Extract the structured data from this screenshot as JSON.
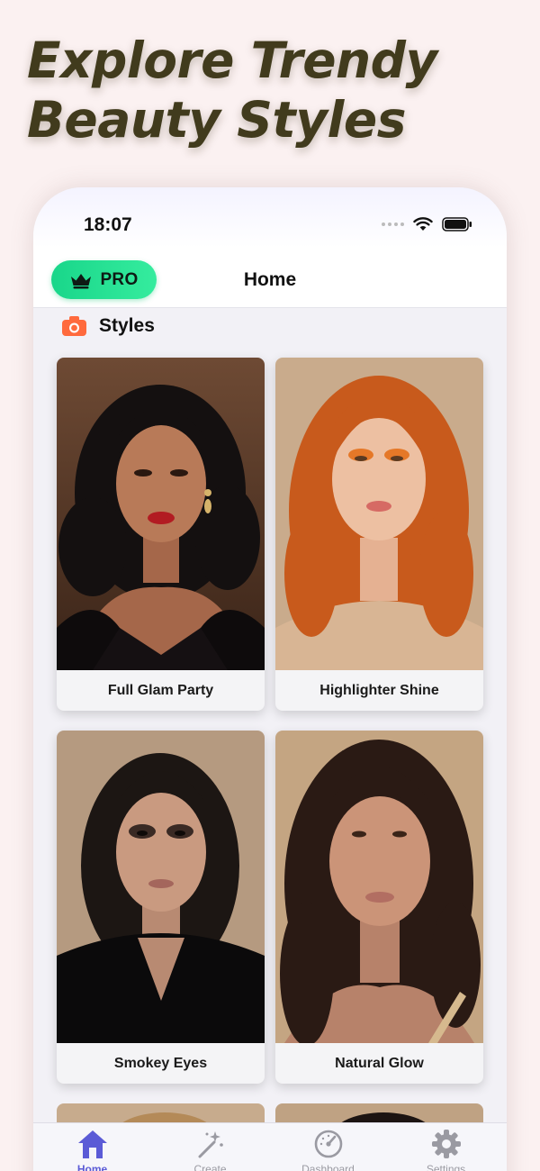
{
  "promo": {
    "headline_line1": "Explore Trendy",
    "headline_line2": "Beauty Styles"
  },
  "status_bar": {
    "time": "18:07"
  },
  "nav": {
    "pro_label": "PRO",
    "title": "Home"
  },
  "section": {
    "title": "Styles",
    "icon": "camera-icon"
  },
  "styles": [
    {
      "label": "Full Glam Party"
    },
    {
      "label": "Highlighter Shine"
    },
    {
      "label": "Smokey Eyes"
    },
    {
      "label": "Natural Glow"
    }
  ],
  "tabs": [
    {
      "label": "Home",
      "icon": "home-icon",
      "active": true
    },
    {
      "label": "Create",
      "icon": "magic-wand-icon",
      "active": false
    },
    {
      "label": "Dashboard",
      "icon": "speedometer-icon",
      "active": false
    },
    {
      "label": "Settings",
      "icon": "gear-icon",
      "active": false
    }
  ],
  "colors": {
    "background": "#fbf1f1",
    "headline": "#413b1d",
    "pro_green": "#1fdc8f",
    "accent": "#5b5bd6",
    "section_icon": "#ff6a3d"
  }
}
